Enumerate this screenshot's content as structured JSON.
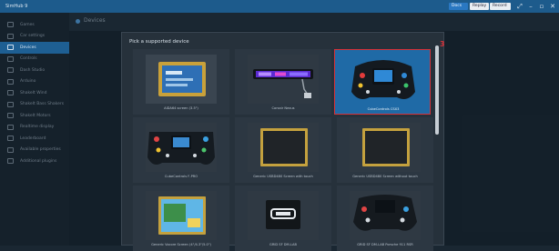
{
  "app": {
    "title": "SimHub 9"
  },
  "titlebar": {
    "docs_label": "Docs",
    "replay_label": "Replay",
    "record_label": "Record",
    "controls": [
      "⤢",
      "–",
      "▫",
      "✕"
    ]
  },
  "sidebar": {
    "items": [
      {
        "label": "Games"
      },
      {
        "label": "Car settings"
      },
      {
        "label": "Devices",
        "active": true
      },
      {
        "label": "Controls"
      },
      {
        "label": "Dash Studio"
      },
      {
        "label": "Arduino"
      },
      {
        "label": "ShakeIt Wind"
      },
      {
        "label": "ShakeIt Bass Shakers"
      },
      {
        "label": "ShakeIt Motors"
      },
      {
        "label": "Realtime display"
      },
      {
        "label": "Leaderboard"
      },
      {
        "label": "Available properties"
      },
      {
        "label": "Additional plugins"
      }
    ]
  },
  "main": {
    "title": "Devices"
  },
  "dialog": {
    "title": "Pick a supported device",
    "badge": "3",
    "devices": [
      {
        "label": "AIDA64 screen (3.5\")",
        "selected": false
      },
      {
        "label": "Corsair Nexus",
        "selected": false
      },
      {
        "label": "CubeControls CSX3",
        "selected": true
      },
      {
        "label": "CubeControls F-PRO",
        "selected": false
      },
      {
        "label": "Generic USBD480 Screen with touch",
        "selected": false
      },
      {
        "label": "Generic USBD480 Screen without touch",
        "selected": false
      },
      {
        "label": "Generic Vocore Screen (4\"/4.3\"/5.0\")",
        "selected": false
      },
      {
        "label": "GRID SF DM-LAB",
        "selected": false
      },
      {
        "label": "GRID SF DM-LAB Porsche 911 RSR",
        "selected": false
      }
    ]
  },
  "colors": {
    "accent": "#1e5f93",
    "titlebar": "#1d5b8c",
    "selection_outline": "#d7323a",
    "background": "#1a2732"
  }
}
